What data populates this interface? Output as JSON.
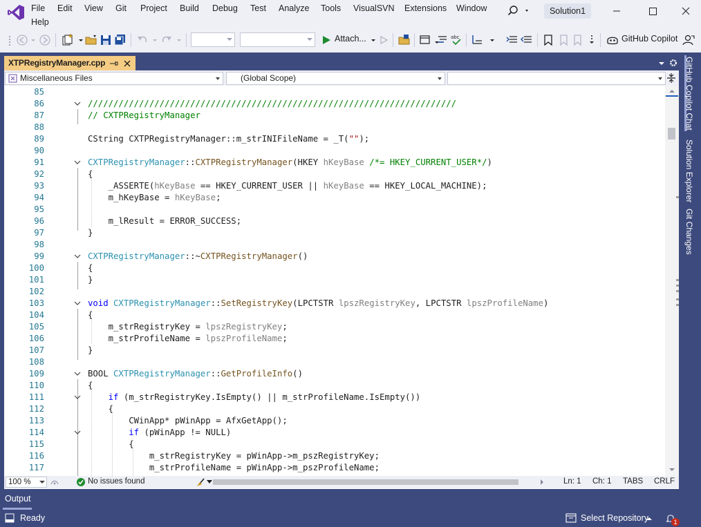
{
  "menu": {
    "items": [
      "File",
      "Edit",
      "View",
      "Git",
      "Project",
      "Build",
      "Debug",
      "Test",
      "Analyze",
      "Tools",
      "VisualSVN",
      "Extensions",
      "Window"
    ],
    "help": "Help"
  },
  "solution_name": "Solution1",
  "toolbar": {
    "attach_label": "Attach...",
    "copilot_label": "GitHub Copilot"
  },
  "document": {
    "tab_title": "XTPRegistryManager.cpp",
    "project_combo": "Miscellaneous Files",
    "scope_combo": "(Global Scope)",
    "member_combo": ""
  },
  "code_lines": [
    {
      "n": "85",
      "tokens": []
    },
    {
      "n": "86",
      "tokens": [
        [
          "c",
          "////////////////////////////////////////////////////////////////////////"
        ]
      ]
    },
    {
      "n": "87",
      "tokens": [
        [
          "c",
          "// CXTPRegistryManager"
        ]
      ]
    },
    {
      "n": "88",
      "tokens": []
    },
    {
      "n": "89",
      "tokens": [
        [
          "n",
          "CString CXTPRegistryManager::m_strINIFileName = _T("
        ],
        [
          "s",
          "\"\""
        ],
        [
          "n",
          ");"
        ]
      ]
    },
    {
      "n": "90",
      "tokens": []
    },
    {
      "n": "91",
      "tokens": [
        [
          "t",
          "CXTPRegistryManager"
        ],
        [
          "n",
          "::"
        ],
        [
          "f",
          "CXTPRegistryManager"
        ],
        [
          "n",
          "(HKEY "
        ],
        [
          "p",
          "hKeyBase"
        ],
        [
          "n",
          " "
        ],
        [
          "c",
          "/*= HKEY_CURRENT_USER*/"
        ],
        [
          "n",
          ")"
        ]
      ]
    },
    {
      "n": "92",
      "tokens": [
        [
          "n",
          "{"
        ]
      ]
    },
    {
      "n": "93",
      "tokens": [
        [
          "n",
          "    _ASSERTE("
        ],
        [
          "p",
          "hKeyBase"
        ],
        [
          "n",
          " == HKEY_CURRENT_USER || "
        ],
        [
          "p",
          "hKeyBase"
        ],
        [
          "n",
          " == HKEY_LOCAL_MACHINE);"
        ]
      ]
    },
    {
      "n": "94",
      "tokens": [
        [
          "n",
          "    m_hKeyBase = "
        ],
        [
          "p",
          "hKeyBase"
        ],
        [
          "n",
          ";"
        ]
      ]
    },
    {
      "n": "95",
      "tokens": []
    },
    {
      "n": "96",
      "tokens": [
        [
          "n",
          "    m_lResult = ERROR_SUCCESS;"
        ]
      ]
    },
    {
      "n": "97",
      "tokens": [
        [
          "n",
          "}"
        ]
      ]
    },
    {
      "n": "98",
      "tokens": []
    },
    {
      "n": "99",
      "tokens": [
        [
          "t",
          "CXTPRegistryManager"
        ],
        [
          "n",
          "::~"
        ],
        [
          "f",
          "CXTPRegistryManager"
        ],
        [
          "n",
          "()"
        ]
      ]
    },
    {
      "n": "100",
      "tokens": [
        [
          "n",
          "{"
        ]
      ]
    },
    {
      "n": "101",
      "tokens": [
        [
          "n",
          "}"
        ]
      ]
    },
    {
      "n": "102",
      "tokens": []
    },
    {
      "n": "103",
      "tokens": [
        [
          "k",
          "void"
        ],
        [
          "n",
          " "
        ],
        [
          "t",
          "CXTPRegistryManager"
        ],
        [
          "n",
          "::"
        ],
        [
          "f",
          "SetRegistryKey"
        ],
        [
          "n",
          "(LPCTSTR "
        ],
        [
          "p",
          "lpszRegistryKey"
        ],
        [
          "n",
          ", LPCTSTR "
        ],
        [
          "p",
          "lpszProfileName"
        ],
        [
          "n",
          ")"
        ]
      ]
    },
    {
      "n": "104",
      "tokens": [
        [
          "n",
          "{"
        ]
      ]
    },
    {
      "n": "105",
      "tokens": [
        [
          "n",
          "    m_strRegistryKey = "
        ],
        [
          "p",
          "lpszRegistryKey"
        ],
        [
          "n",
          ";"
        ]
      ]
    },
    {
      "n": "106",
      "tokens": [
        [
          "n",
          "    m_strProfileName = "
        ],
        [
          "p",
          "lpszProfileName"
        ],
        [
          "n",
          ";"
        ]
      ]
    },
    {
      "n": "107",
      "tokens": [
        [
          "n",
          "}"
        ]
      ]
    },
    {
      "n": "108",
      "tokens": []
    },
    {
      "n": "109",
      "tokens": [
        [
          "n",
          "BOOL "
        ],
        [
          "t",
          "CXTPRegistryManager"
        ],
        [
          "n",
          "::"
        ],
        [
          "f",
          "GetProfileInfo"
        ],
        [
          "n",
          "()"
        ]
      ]
    },
    {
      "n": "110",
      "tokens": [
        [
          "n",
          "{"
        ]
      ]
    },
    {
      "n": "111",
      "tokens": [
        [
          "n",
          "    "
        ],
        [
          "k",
          "if"
        ],
        [
          "n",
          " (m_strRegistryKey.IsEmpty() || m_strProfileName.IsEmpty())"
        ]
      ]
    },
    {
      "n": "112",
      "tokens": [
        [
          "n",
          "    {"
        ]
      ]
    },
    {
      "n": "113",
      "tokens": [
        [
          "n",
          "        CWinApp* pWinApp = AfxGetApp();"
        ]
      ]
    },
    {
      "n": "114",
      "tokens": [
        [
          "n",
          "        "
        ],
        [
          "k",
          "if"
        ],
        [
          "n",
          " (pWinApp != NULL)"
        ]
      ]
    },
    {
      "n": "115",
      "tokens": [
        [
          "n",
          "        {"
        ]
      ]
    },
    {
      "n": "116",
      "tokens": [
        [
          "n",
          "            m_strRegistryKey = pWinApp->m_pszRegistryKey;"
        ]
      ]
    },
    {
      "n": "117",
      "tokens": [
        [
          "n",
          "            m_strProfileName = pWinApp->m_pszProfileName;"
        ]
      ]
    }
  ],
  "editor_status": {
    "zoom": "100 %",
    "issues": "No issues found",
    "line": "Ln: 1",
    "col": "Ch: 1",
    "tabs": "TABS",
    "eol": "CRLF"
  },
  "side_panels": [
    "GitHub Copilot Chat",
    "Solution Explorer",
    "Git Changes"
  ],
  "output_tab": "Output",
  "status": {
    "ready": "Ready",
    "repo": "Select Repository",
    "notifications": "1"
  }
}
